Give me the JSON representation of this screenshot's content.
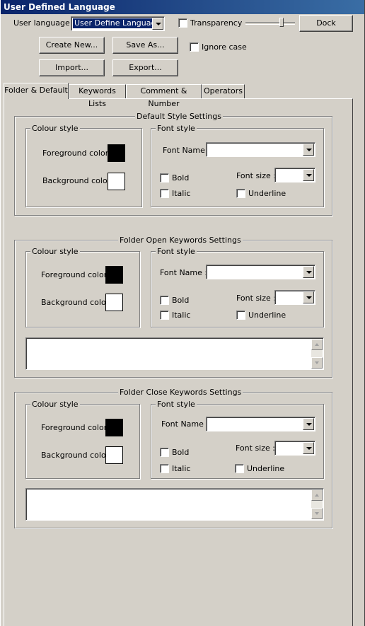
{
  "window": {
    "title": "User Defined Language"
  },
  "toolbar": {
    "user_language_label": "User language :",
    "user_language_value": "User Define Language",
    "transparency_label": "Transparency",
    "dock_label": "Dock",
    "create_new_label": "Create New...",
    "save_as_label": "Save As...",
    "ignore_case_label": "Ignore case",
    "import_label": "Import...",
    "export_label": "Export..."
  },
  "tabs": [
    {
      "label": "Folder & Default"
    },
    {
      "label": "Keywords Lists"
    },
    {
      "label": "Comment & Number"
    },
    {
      "label": "Operators"
    }
  ],
  "common": {
    "colour_style": "Colour style",
    "font_style": "Font style",
    "foreground": "Foreground color",
    "background": "Background color",
    "font_name": "Font Name :",
    "font_size": "Font size :",
    "bold": "Bold",
    "italic": "Italic",
    "underline": "Underline"
  },
  "sections": [
    {
      "title": "Default Style Settings"
    },
    {
      "title": "Folder Open Keywords Settings"
    },
    {
      "title": "Folder Close Keywords Settings"
    }
  ],
  "colors": {
    "foreground": "#000000",
    "background": "#ffffff",
    "title_bar": "#0a246a"
  }
}
